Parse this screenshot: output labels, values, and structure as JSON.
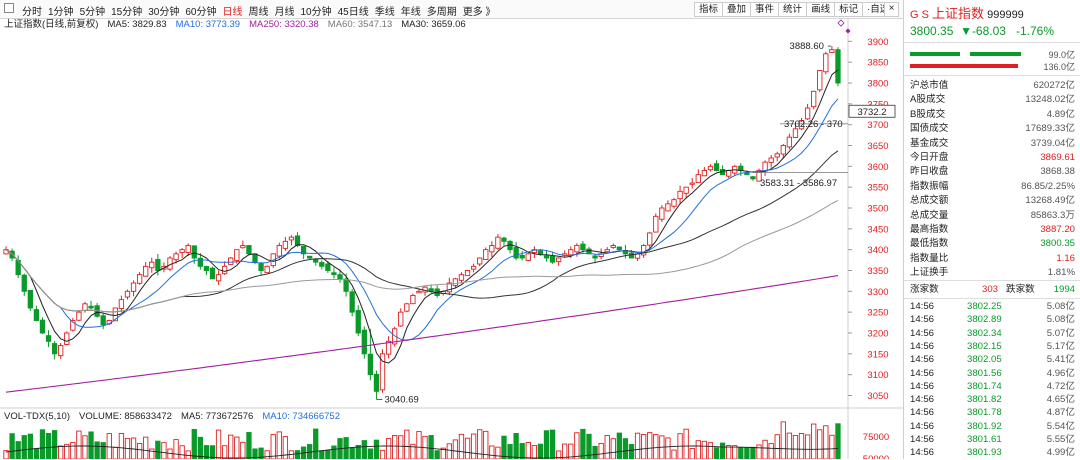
{
  "toolbar": {
    "periods": [
      "分时",
      "1分钟",
      "5分钟",
      "15分钟",
      "30分钟",
      "60分钟",
      "日线",
      "周线",
      "月线",
      "10分钟",
      "45日线",
      "季线",
      "年线",
      "多周期",
      "更多 》"
    ],
    "active_period": "日线",
    "tools": [
      "指标",
      "叠加",
      "事件",
      "统计",
      "画线",
      "标记",
      "·自选"
    ],
    "close": "×"
  },
  "ma_legend": {
    "title": "上证指数(日线,前复权)",
    "ma5": "MA5: 3829.83",
    "ma10": "MA10: 3773.39",
    "ma250": "MA250: 3320.38",
    "ma60": "MA60: 3547.13",
    "ma30": "MA30: 3659.06"
  },
  "vol_legend": {
    "title": "VOL-TDX(5,10)",
    "volume": "VOLUME: 858633472",
    "ma5": "MA5: 773672576",
    "ma10": "MA10: 734666752"
  },
  "axis": {
    "ticks": [
      "3900",
      "3850",
      "3800",
      "3750",
      "3700",
      "3650",
      "3600",
      "3550",
      "3500",
      "3450",
      "3400",
      "3350",
      "3300",
      "3250",
      "3200",
      "3150",
      "3100",
      "3050"
    ],
    "current_label": "3732.2",
    "vol_tick": "75000",
    "vol_tick2": "50000"
  },
  "annotations": {
    "high": "3888.60",
    "low": "3040.69",
    "range1": "3702.26 - 370",
    "range2": "3583.31 - 3586.97"
  },
  "colors": {
    "up": "#e02020",
    "down": "#0a9a2a",
    "ma5": "#222222",
    "ma10": "#1f6fe0",
    "ma30": "#333333",
    "ma60": "#999999",
    "ma250": "#a020a0"
  },
  "quote": {
    "code_prefix": "G  S",
    "name": "上证指数",
    "code": "999999",
    "price": "3800.35",
    "change": "▼-68.03",
    "pct": "-1.76%",
    "bar1_label": "99.0亿",
    "bar2_label": "136.0亿",
    "buy_frac": 0.42,
    "sell_frac": 0.58
  },
  "stats": [
    {
      "label": "沪总市值",
      "value": "620272亿",
      "color": "gray"
    },
    {
      "label": "A股成交",
      "value": "13248.02亿",
      "color": "gray"
    },
    {
      "label": "B股成交",
      "value": "4.89亿",
      "color": "gray"
    },
    {
      "label": "国债成交",
      "value": "17689.33亿",
      "color": "gray"
    },
    {
      "label": "基金成交",
      "value": "3739.04亿",
      "color": "gray"
    },
    {
      "label": "今日开盘",
      "value": "3869.61",
      "color": "red"
    },
    {
      "label": "昨日收盘",
      "value": "3868.38",
      "color": "gray"
    },
    {
      "label": "指数振幅",
      "value": "86.85/2.25%",
      "color": "gray"
    },
    {
      "label": "总成交额",
      "value": "13268.49亿",
      "color": "gray"
    },
    {
      "label": "总成交量",
      "value": "85863.3万",
      "color": "gray"
    },
    {
      "label": "最高指数",
      "value": "3887.20",
      "color": "red"
    },
    {
      "label": "最低指数",
      "value": "3800.35",
      "color": "green"
    },
    {
      "label": "指数量比",
      "value": "1.16",
      "color": "red"
    },
    {
      "label": "上证换手",
      "value": "1.81%",
      "color": "gray"
    }
  ],
  "breadth": {
    "up_label": "涨家数",
    "up": "303",
    "down_label": "跌家数",
    "down": "1994"
  },
  "ticks": [
    {
      "time": "14:56",
      "price": "3802.25",
      "vol": "5.08亿"
    },
    {
      "time": "14:56",
      "price": "3802.89",
      "vol": "5.08亿"
    },
    {
      "time": "14:56",
      "price": "3802.34",
      "vol": "5.07亿"
    },
    {
      "time": "14:56",
      "price": "3802.15",
      "vol": "5.17亿"
    },
    {
      "time": "14:56",
      "price": "3802.05",
      "vol": "5.41亿"
    },
    {
      "time": "14:56",
      "price": "3801.56",
      "vol": "4.96亿"
    },
    {
      "time": "14:56",
      "price": "3801.74",
      "vol": "4.72亿"
    },
    {
      "time": "14:56",
      "price": "3801.82",
      "vol": "4.65亿"
    },
    {
      "time": "14:56",
      "price": "3801.78",
      "vol": "4.87亿"
    },
    {
      "time": "14:56",
      "price": "3801.92",
      "vol": "5.54亿"
    },
    {
      "time": "14:56",
      "price": "3801.61",
      "vol": "5.55亿"
    },
    {
      "time": "14:56",
      "price": "3801.93",
      "vol": "4.99亿"
    }
  ],
  "chart_data": {
    "type": "candlestick",
    "ylim": [
      3020,
      3920
    ],
    "closes": [
      3400,
      3380,
      3340,
      3300,
      3260,
      3230,
      3200,
      3180,
      3150,
      3170,
      3200,
      3230,
      3250,
      3270,
      3260,
      3240,
      3220,
      3230,
      3260,
      3280,
      3300,
      3320,
      3340,
      3360,
      3370,
      3350,
      3360,
      3380,
      3390,
      3400,
      3410,
      3380,
      3360,
      3350,
      3330,
      3340,
      3360,
      3380,
      3400,
      3410,
      3390,
      3370,
      3350,
      3360,
      3390,
      3410,
      3420,
      3430,
      3410,
      3390,
      3380,
      3370,
      3360,
      3350,
      3340,
      3330,
      3300,
      3250,
      3200,
      3150,
      3100,
      3060,
      3150,
      3180,
      3210,
      3250,
      3270,
      3290,
      3300,
      3310,
      3300,
      3290,
      3300,
      3320,
      3330,
      3340,
      3350,
      3360,
      3380,
      3400,
      3410,
      3430,
      3420,
      3400,
      3380,
      3380,
      3390,
      3400,
      3390,
      3380,
      3370,
      3380,
      3390,
      3400,
      3410,
      3400,
      3390,
      3380,
      3390,
      3400,
      3410,
      3400,
      3390,
      3380,
      3390,
      3410,
      3440,
      3480,
      3500,
      3510,
      3520,
      3540,
      3550,
      3560,
      3580,
      3590,
      3600,
      3590,
      3580,
      3590,
      3600,
      3590,
      3580,
      3570,
      3590,
      3610,
      3620,
      3630,
      3650,
      3670,
      3690,
      3710,
      3740,
      3780,
      3830,
      3870,
      3880,
      3800
    ]
  }
}
